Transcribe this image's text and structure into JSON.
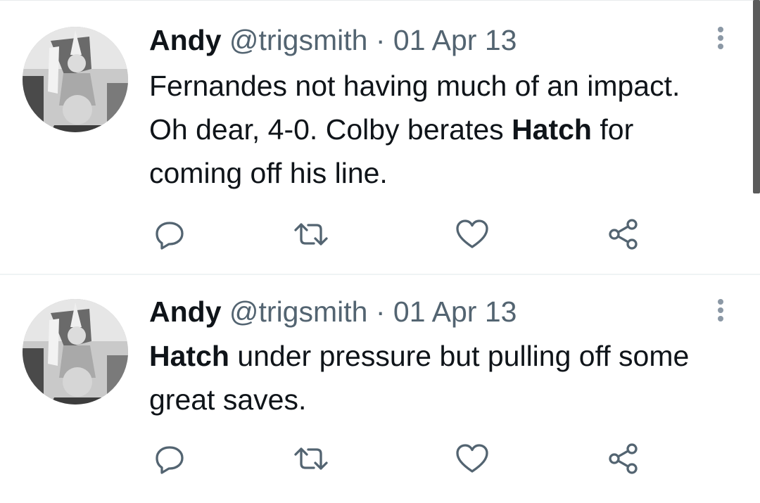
{
  "tweets": [
    {
      "author_name": "Andy",
      "handle": "@trigsmith",
      "separator": "·",
      "date": "01 Apr 13",
      "segments": [
        {
          "text": "Fernandes not having much of an impact. Oh dear, 4-0. Colby berates ",
          "bold": false
        },
        {
          "text": "Hatch",
          "bold": true
        },
        {
          "text": " for coming off his line.",
          "bold": false
        }
      ],
      "actions": {
        "reply_icon": "reply-icon",
        "retweet_icon": "retweet-icon",
        "like_icon": "heart-icon",
        "share_icon": "share-icon"
      }
    },
    {
      "author_name": "Andy",
      "handle": "@trigsmith",
      "separator": "·",
      "date": "01 Apr 13",
      "segments": [
        {
          "text": "Hatch",
          "bold": true
        },
        {
          "text": " under pressure but pulling off some great saves.",
          "bold": false
        }
      ],
      "actions": {
        "reply_icon": "reply-icon",
        "retweet_icon": "retweet-icon",
        "like_icon": "heart-icon",
        "share_icon": "share-icon"
      }
    }
  ],
  "colors": {
    "text": "#0f1419",
    "secondary": "#536471",
    "divider": "#eff3f4",
    "icon": "#536471"
  }
}
